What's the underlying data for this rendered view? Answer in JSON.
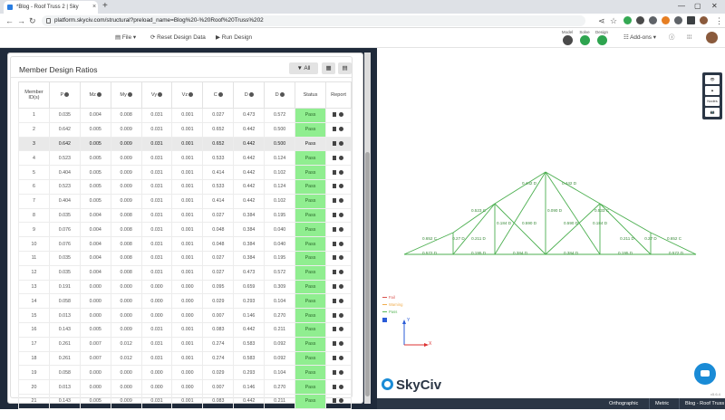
{
  "browser": {
    "tab_title": "*Blog - Roof Truss 2 | Sky",
    "tab_close": "×",
    "new_tab": "+",
    "url": "platform.skyciv.com/structural?preload_name=Blog%20-%20Roof%20Truss%202"
  },
  "toolbar": {
    "file_label": "File ▾",
    "reset_label": "Reset Design Data",
    "run_label": "Run Design",
    "modes": [
      {
        "label": "Model"
      },
      {
        "label": "Solve"
      },
      {
        "label": "Design"
      }
    ],
    "addons_label": "Add-ons ▾"
  },
  "card": {
    "title": "Member Design Ratios",
    "filter_label": "All"
  },
  "table": {
    "headers": [
      "Member ID(s)",
      "P",
      "Mz",
      "My",
      "Vy",
      "Vz",
      "C",
      "D",
      "D",
      "Status",
      "Report"
    ],
    "rows": [
      [
        "1",
        "0.035",
        "0.004",
        "0.008",
        "0.031",
        "0.001",
        "0.027",
        "0.473",
        "0.572",
        "Pass"
      ],
      [
        "2",
        "0.642",
        "0.005",
        "0.009",
        "0.031",
        "0.001",
        "0.652",
        "0.442",
        "0.500",
        "Pass"
      ],
      [
        "3",
        "0.642",
        "0.005",
        "0.009",
        "0.031",
        "0.001",
        "0.652",
        "0.442",
        "0.500",
        "Pass"
      ],
      [
        "4",
        "0.523",
        "0.005",
        "0.009",
        "0.031",
        "0.001",
        "0.533",
        "0.442",
        "0.124",
        "Pass"
      ],
      [
        "5",
        "0.404",
        "0.005",
        "0.009",
        "0.031",
        "0.001",
        "0.414",
        "0.442",
        "0.102",
        "Pass"
      ],
      [
        "6",
        "0.523",
        "0.005",
        "0.009",
        "0.031",
        "0.001",
        "0.533",
        "0.442",
        "0.124",
        "Pass"
      ],
      [
        "7",
        "0.404",
        "0.005",
        "0.009",
        "0.031",
        "0.001",
        "0.414",
        "0.442",
        "0.102",
        "Pass"
      ],
      [
        "8",
        "0.035",
        "0.004",
        "0.008",
        "0.031",
        "0.001",
        "0.027",
        "0.384",
        "0.195",
        "Pass"
      ],
      [
        "9",
        "0.076",
        "0.004",
        "0.008",
        "0.031",
        "0.001",
        "0.048",
        "0.384",
        "0.040",
        "Pass"
      ],
      [
        "10",
        "0.076",
        "0.004",
        "0.008",
        "0.031",
        "0.001",
        "0.048",
        "0.384",
        "0.040",
        "Pass"
      ],
      [
        "11",
        "0.035",
        "0.004",
        "0.008",
        "0.031",
        "0.001",
        "0.027",
        "0.384",
        "0.195",
        "Pass"
      ],
      [
        "12",
        "0.035",
        "0.004",
        "0.008",
        "0.031",
        "0.001",
        "0.027",
        "0.473",
        "0.572",
        "Pass"
      ],
      [
        "13",
        "0.191",
        "0.000",
        "0.000",
        "0.000",
        "0.000",
        "0.095",
        "0.659",
        "0.309",
        "Pass"
      ],
      [
        "14",
        "0.058",
        "0.000",
        "0.000",
        "0.000",
        "0.000",
        "0.029",
        "0.293",
        "0.104",
        "Pass"
      ],
      [
        "15",
        "0.013",
        "0.000",
        "0.000",
        "0.000",
        "0.000",
        "0.007",
        "0.146",
        "0.270",
        "Pass"
      ],
      [
        "16",
        "0.143",
        "0.005",
        "0.009",
        "0.031",
        "0.001",
        "0.083",
        "0.442",
        "0.211",
        "Pass"
      ],
      [
        "17",
        "0.261",
        "0.007",
        "0.012",
        "0.031",
        "0.001",
        "0.274",
        "0.583",
        "0.092",
        "Pass"
      ],
      [
        "18",
        "0.261",
        "0.007",
        "0.012",
        "0.031",
        "0.001",
        "0.274",
        "0.583",
        "0.092",
        "Pass"
      ],
      [
        "19",
        "0.058",
        "0.000",
        "0.000",
        "0.000",
        "0.000",
        "0.029",
        "0.293",
        "0.104",
        "Pass"
      ],
      [
        "20",
        "0.013",
        "0.000",
        "0.000",
        "0.000",
        "0.000",
        "0.007",
        "0.146",
        "0.270",
        "Pass"
      ],
      [
        "21",
        "0.143",
        "0.005",
        "0.009",
        "0.031",
        "0.001",
        "0.083",
        "0.442",
        "0.211",
        "Pass"
      ]
    ],
    "selected_row": 2
  },
  "viewport": {
    "view_tools": [
      "👁",
      "▲",
      "Nodes",
      "📷"
    ],
    "legend": [
      {
        "label": "Fail",
        "color": "#d9534f"
      },
      {
        "label": "Warning",
        "color": "#f0ad4e"
      },
      {
        "label": "Pass",
        "color": "#5cb85c"
      }
    ],
    "axis_y": "Y",
    "axis_x": "X",
    "member_labels": [
      "0.442 D",
      "0.442 D",
      "0.523 C",
      "0.533 C",
      "0.184 D",
      "0.590 D",
      "0.090 D",
      "0.590 D",
      "0.184 D",
      "0.652 C",
      "0.27 D",
      "0.211 D",
      "0.211 D",
      "0.27 D",
      "0.652 C",
      "0.572 D",
      "0.195 D",
      "0.384 D",
      "0.384 D",
      "0.195 D",
      "0.572 D"
    ],
    "logo_text": "SkyCiv",
    "version": "v5.6.4"
  },
  "statusbar": {
    "items": [
      "Orthographic",
      "Metric",
      "Blog - Roof Truss 2*"
    ]
  },
  "colors": {
    "pass_green": "#90ee90",
    "truss_green": "#4caf50",
    "accent_blue": "#1a8bd6",
    "dark_panel": "#1f2a3a"
  }
}
